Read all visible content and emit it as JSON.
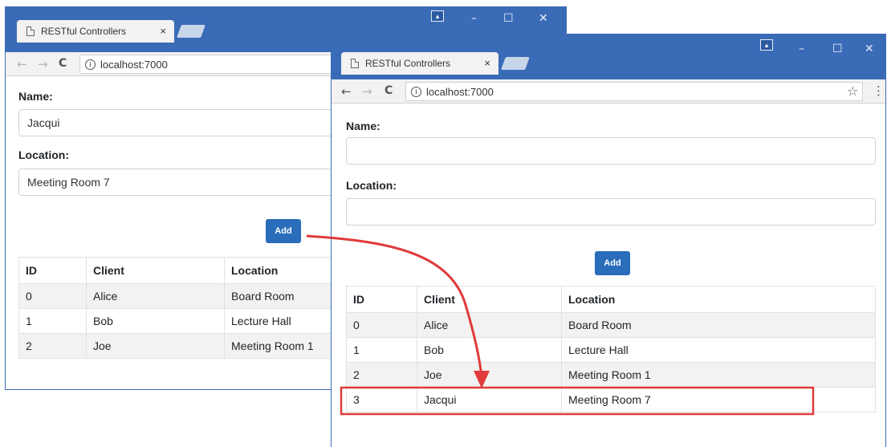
{
  "left_window": {
    "tab_title": "RESTful Controllers",
    "tab_close": "×",
    "window_controls": {
      "user": "▴",
      "minimize": "–",
      "maximize": "☐",
      "close": "✕"
    },
    "nav": {
      "back": "←",
      "forward": "→",
      "reload": "C"
    },
    "address": "localhost:7000",
    "form": {
      "name_label": "Name:",
      "name_value": "Jacqui",
      "location_label": "Location:",
      "location_value": "Meeting Room 7",
      "add_label": "Add"
    },
    "table": {
      "headers": [
        "ID",
        "Client",
        "Location"
      ],
      "rows": [
        [
          "0",
          "Alice",
          "Board Room"
        ],
        [
          "1",
          "Bob",
          "Lecture Hall"
        ],
        [
          "2",
          "Joe",
          "Meeting Room 1"
        ]
      ]
    }
  },
  "right_window": {
    "tab_title": "RESTful Controllers",
    "tab_close": "×",
    "window_controls": {
      "user": "▴",
      "minimize": "–",
      "maximize": "☐",
      "close": "✕"
    },
    "nav": {
      "back": "←",
      "forward": "→",
      "reload": "C"
    },
    "address": "localhost:7000",
    "star": "☆",
    "menu": "⋮",
    "form": {
      "name_label": "Name:",
      "name_value": "",
      "location_label": "Location:",
      "location_value": "",
      "add_label": "Add"
    },
    "table": {
      "headers": [
        "ID",
        "Client",
        "Location"
      ],
      "rows": [
        [
          "0",
          "Alice",
          "Board Room"
        ],
        [
          "1",
          "Bob",
          "Lecture Hall"
        ],
        [
          "2",
          "Joe",
          "Meeting Room 1"
        ],
        [
          "3",
          "Jacqui",
          "Meeting Room 7"
        ]
      ]
    }
  },
  "annotation": {
    "arrow_color": "#e03a3a",
    "highlight_color": "#e03a3a"
  }
}
